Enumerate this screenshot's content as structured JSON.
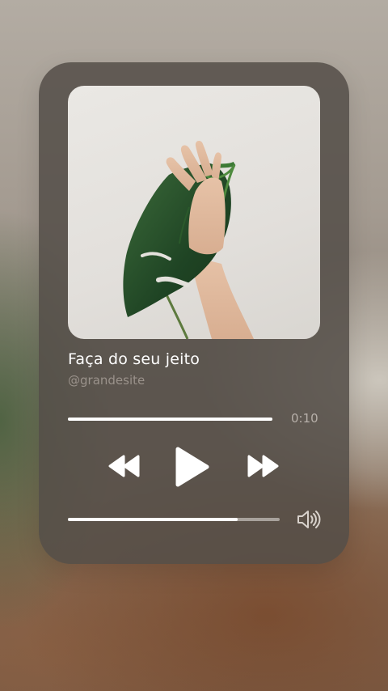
{
  "player": {
    "track_title": "Faça do seu jeito",
    "artist": "@grandesite",
    "time": "0:10",
    "progress": 1.0,
    "volume": 0.8,
    "artwork": "hand holding monstera leaf"
  },
  "controls": {
    "rewind_icon": "rewind-icon",
    "play_icon": "play-icon",
    "forward_icon": "fast-forward-icon",
    "volume_icon": "speaker-icon"
  },
  "colors": {
    "card": "#544e48",
    "text": "#ffffff",
    "muted": "#9a928b"
  }
}
